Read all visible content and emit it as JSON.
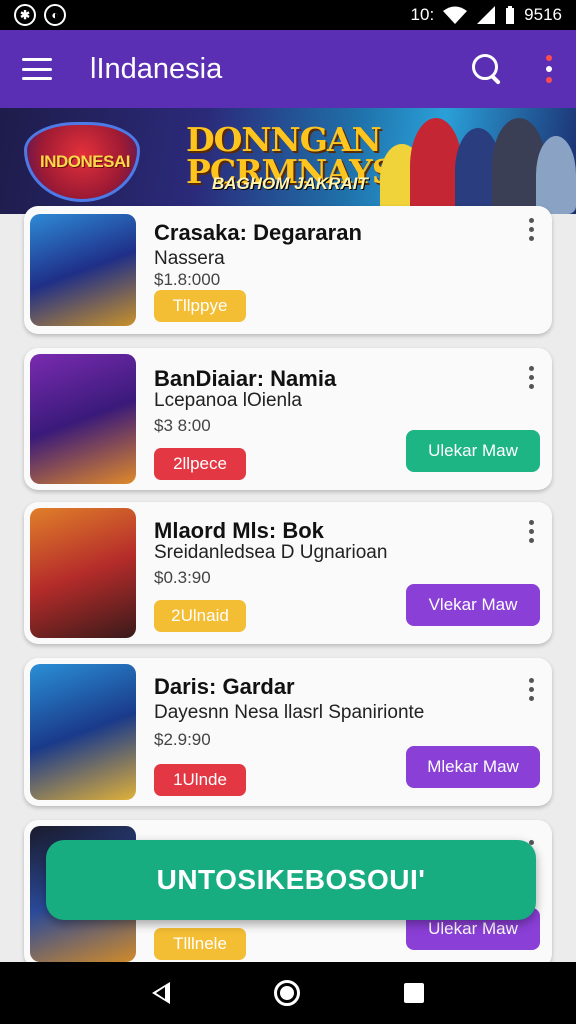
{
  "status_bar": {
    "time": "9516",
    "left_icons": [
      "assistant-icon",
      "notification-icon"
    ],
    "right_icons": [
      "signal-icon",
      "wifi-icon",
      "battery-icon"
    ],
    "indicator": "10:"
  },
  "app_bar": {
    "title": "lIndanesia",
    "icons": [
      "menu-icon",
      "search-icon",
      "more-vert-icon"
    ]
  },
  "banner": {
    "brand": "INDONESAI",
    "headline_1": "DONNGAN",
    "headline_2": "PCRMNAYS",
    "subtitle": "BAGHOM JAKRAIT"
  },
  "games": [
    {
      "title": "Crasaka: Degararan",
      "subtitle": "Nassera",
      "price": "$1.8:000",
      "tag": "Tllppye",
      "tag_color": "#f3bd34",
      "action": ""
    },
    {
      "title": "BanDiaiar: Namia",
      "subtitle": "Lcepanoa lOienla",
      "price": "$3 8:00",
      "tag": "2llpece",
      "tag_color": "#e33744",
      "action": "Ulekar Maw",
      "action_color": "#1db584"
    },
    {
      "title": "Mlaord Mls: Bok",
      "subtitle": "Sreidanledsea D Ugnarioan",
      "price": "$0.3:90",
      "tag": "2Ulnaid",
      "tag_color": "#f3bd34",
      "action": "Vlekar Maw",
      "action_color": "#8a3fd6"
    },
    {
      "title": "Daris: Gardar",
      "subtitle": "Dayesnn Nesa llasrl Spanirionte",
      "price": "$2.9:90",
      "tag": "1Ulnde",
      "tag_color": "#e33744",
      "action": "Mlekar Maw",
      "action_color": "#8a3fd6"
    },
    {
      "title": "",
      "subtitle": "",
      "price": "",
      "tag": "Tlllnele",
      "tag_color": "#f3bd34",
      "action": "Ulekar Maw",
      "action_color": "#8a3fd6"
    }
  ],
  "fab": {
    "label": "UNTOSIKEBOSOUI'"
  },
  "nav_bar": {
    "icons": [
      "back-icon",
      "home-icon",
      "recents-icon"
    ]
  }
}
